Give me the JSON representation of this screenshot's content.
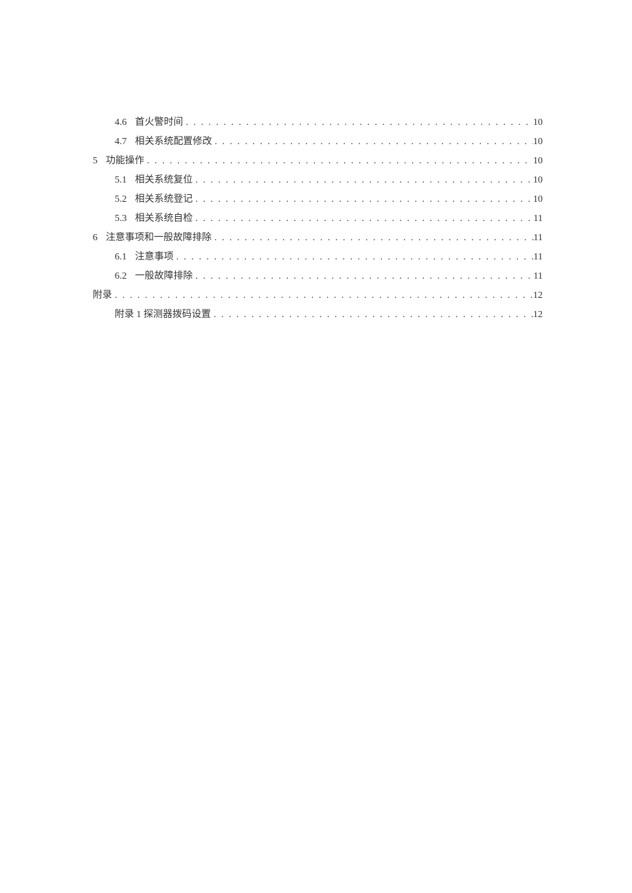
{
  "toc": [
    {
      "level": 2,
      "num": "4.6",
      "title": "首火警时间",
      "page": "10"
    },
    {
      "level": 2,
      "num": "4.7",
      "title": "相关系统配置修改",
      "page": "10"
    },
    {
      "level": 1,
      "num": "5",
      "title": "功能操作",
      "page": "10"
    },
    {
      "level": 2,
      "num": "5.1",
      "title": "相关系统复位",
      "page": "10"
    },
    {
      "level": 2,
      "num": "5.2",
      "title": "相关系统登记",
      "page": "10"
    },
    {
      "level": 2,
      "num": "5.3",
      "title": "相关系统自检",
      "page": "11"
    },
    {
      "level": 1,
      "num": "6",
      "title": "注意事项和一般故障排除",
      "page": "11"
    },
    {
      "level": 2,
      "num": "6.1",
      "title": "注意事项",
      "page": "11"
    },
    {
      "level": 2,
      "num": "6.2",
      "title": "一般故障排除",
      "page": "11"
    },
    {
      "level": 1,
      "num": "",
      "title": "附录",
      "page": "12"
    },
    {
      "level": 2,
      "num": "",
      "title": "附录 1 探测器拨码设置",
      "page": "12"
    }
  ]
}
